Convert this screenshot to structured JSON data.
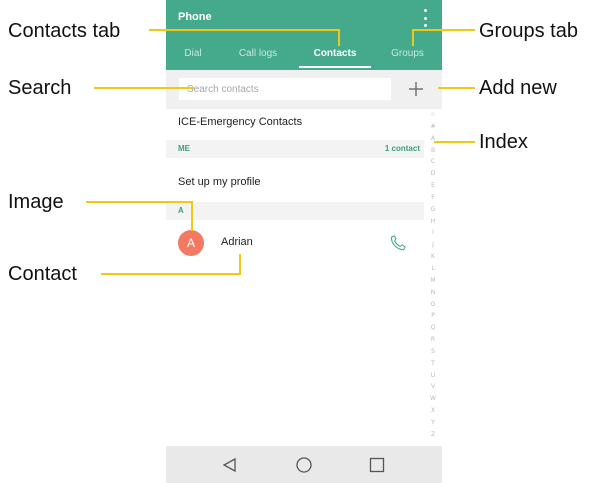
{
  "app": {
    "title": "Phone"
  },
  "tabs": [
    {
      "label": "Dial"
    },
    {
      "label": "Call logs"
    },
    {
      "label": "Contacts"
    },
    {
      "label": "Groups"
    }
  ],
  "active_tab": "Contacts",
  "search": {
    "placeholder": "Search contacts"
  },
  "list": {
    "ice": "ICE-Emergency Contacts",
    "me_section": {
      "letter": "ME",
      "count": "1 contact"
    },
    "profile": "Set up my profile",
    "a_section": {
      "letter": "A"
    },
    "contact": {
      "initial": "A",
      "name": "Adrian"
    }
  },
  "index_letters": [
    "☆",
    "#",
    "A",
    "B",
    "C",
    "D",
    "E",
    "F",
    "G",
    "H",
    "I",
    "J",
    "K",
    "L",
    "M",
    "N",
    "O",
    "P",
    "Q",
    "R",
    "S",
    "T",
    "U",
    "V",
    "W",
    "X",
    "Y",
    "Z"
  ],
  "annotations": {
    "contacts_tab": "Contacts tab",
    "groups_tab": "Groups tab",
    "search": "Search",
    "add_new": "Add new",
    "index": "Index",
    "image": "Image",
    "contact": "Contact"
  },
  "colors": {
    "accent": "#45a98c",
    "leader": "#f1c814",
    "avatar": "#f37a62",
    "section_text": "#3f9e82"
  },
  "icons": {
    "menu": "more-vert-icon",
    "add": "plus-icon",
    "call": "phone-icon",
    "back": "back-triangle-icon",
    "home": "home-circle-icon",
    "recents": "recents-square-icon"
  }
}
